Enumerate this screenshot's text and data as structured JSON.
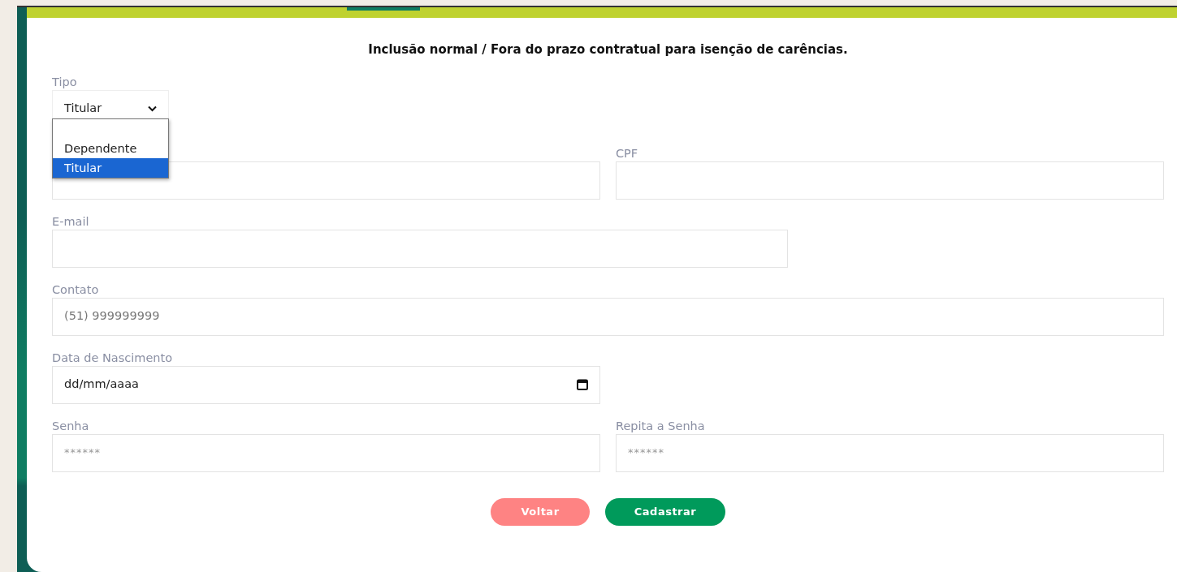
{
  "heading": "Inclusão normal / Fora do prazo contratual para isenção de carências.",
  "tipo": {
    "label": "Tipo",
    "value": "Titular",
    "expanded": true,
    "options": [
      {
        "label": "Dependente",
        "selected": false
      },
      {
        "label": "Titular",
        "selected": true
      }
    ]
  },
  "rows": [
    {
      "fields": [
        {
          "kind": "text"
        },
        {
          "kind": "text",
          "label": "CPF"
        }
      ]
    },
    {
      "fields": [
        {
          "kind": "text",
          "label": "E-mail"
        }
      ]
    },
    {
      "fields": [
        {
          "kind": "text",
          "label": "Contato",
          "placeholder": "(51) 999999999"
        }
      ]
    },
    {
      "fields": [
        {
          "kind": "date",
          "label": "Data de Nascimento",
          "value": "dd/mm/aaaa"
        }
      ]
    },
    {
      "fields": [
        {
          "kind": "password",
          "label": "Senha",
          "placeholder": "******"
        },
        {
          "kind": "password",
          "label": "Repita a Senha",
          "placeholder": "******"
        }
      ]
    }
  ],
  "buttons": [
    {
      "label": "Voltar",
      "kind": "back"
    },
    {
      "label": "Cadastrar",
      "kind": "submit"
    }
  ]
}
